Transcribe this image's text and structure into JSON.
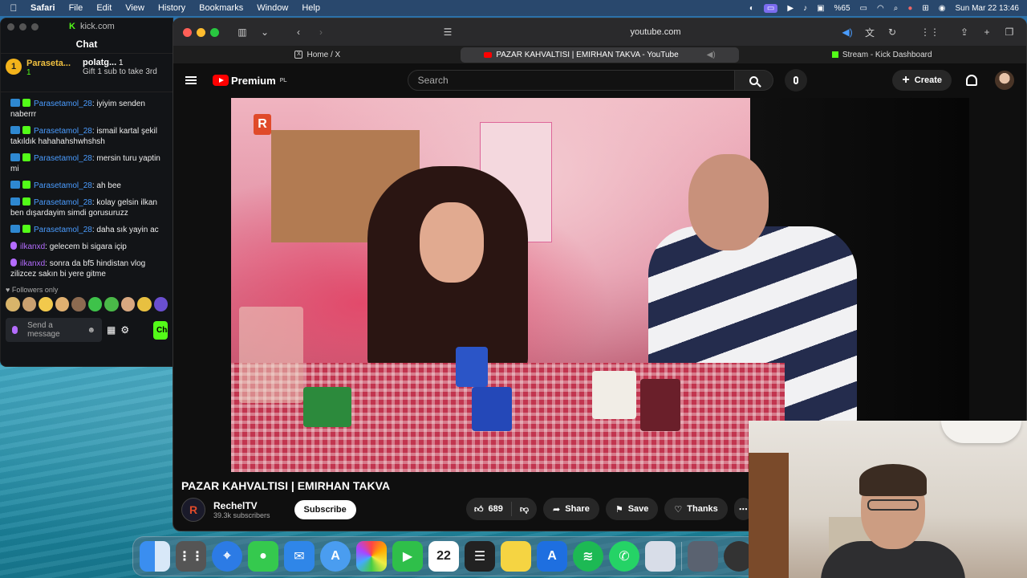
{
  "menubar": {
    "app": "Safari",
    "items": [
      "File",
      "Edit",
      "View",
      "History",
      "Bookmarks",
      "Window",
      "Help"
    ],
    "battery": "%65",
    "datetime": "Sun Mar 22  13:46"
  },
  "kick_window": {
    "title": "kick.com",
    "chat_header": "Chat",
    "pinned": {
      "user1": "Paraseta...",
      "user1_count": "1",
      "user2": "polatg...",
      "user2_count": "1",
      "gift_text": "Gift 1 sub to take 3rd"
    },
    "messages": [
      {
        "user": "Parasetamol_28",
        "text": ": iyiyim senden naberrr"
      },
      {
        "user": "Parasetamol_28",
        "text": ": ismail kartal şekil takıldık hahahahshwhshsh"
      },
      {
        "user": "Parasetamol_28",
        "text": ": mersin turu yaptin mi"
      },
      {
        "user": "Parasetamol_28",
        "text": ": ah bee"
      },
      {
        "user": "Parasetamol_28",
        "text": ": kolay gelsin ilkan ben dışardayim simdi gorusuruzz"
      },
      {
        "user": "Parasetamol_28",
        "text": ": daha sık yayin ac"
      },
      {
        "user": "ilkanxd",
        "text": ": gelecem bi sigara içip"
      },
      {
        "user": "ilkanxd",
        "text": ": sonra da bf5 hindistan vlog zilizcez sakın bi yere gitme"
      }
    ],
    "followers_only": "Followers only",
    "send_placeholder": "Send a message",
    "chat_button": "Chat"
  },
  "safari": {
    "url": "youtube.com",
    "tabs": [
      {
        "label": "Home / X"
      },
      {
        "label": "PAZAR KAHVALTISI | EMIRHAN TAKVA - YouTube"
      },
      {
        "label": "Stream - Kick Dashboard"
      }
    ]
  },
  "youtube": {
    "logo": "Premium",
    "region": "PL",
    "search_placeholder": "Search",
    "create_label": "Create",
    "video_title": "PAZAR KAHVALTISI | EMIRHAN TAKVA",
    "channel_name": "RechelTV",
    "subscribers": "39.3k subscribers",
    "subscribe_label": "Subscribe",
    "likes": "689",
    "share_label": "Share",
    "save_label": "Save",
    "thanks_label": "Thanks"
  },
  "dock": {
    "calendar_day": "22"
  }
}
